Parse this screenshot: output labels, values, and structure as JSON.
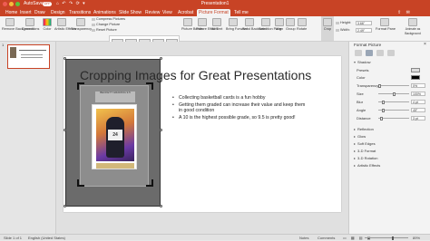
{
  "titlebar": {
    "autosave_label": "AutoSave",
    "toggle_label": "OFF",
    "quick_access": "⌂ ↶ ↷ ⟳ ▾",
    "window_title": "Presentation1"
  },
  "tabs": [
    "Home",
    "Insert",
    "Draw",
    "Design",
    "Transitions",
    "Animations",
    "Slide Show",
    "Review",
    "View",
    "Acrobat",
    "Picture Format",
    "Tell me"
  ],
  "active_tab": "Picture Format",
  "ribbon": {
    "remove_background": "Remove Background",
    "corrections": "Corrections",
    "color": "Color",
    "artistic_effects": "Artistic Effects",
    "transparency": "Transparency",
    "compress_pictures": "Compress Pictures",
    "change_picture": "Change Picture",
    "reset_picture": "Reset Picture",
    "picture_border": "Picture Border",
    "picture_effects": "Picture Effects",
    "alt_text": "Alt Text",
    "bring_forward": "Bring Forward",
    "send_backward": "Send Backward",
    "selection_pane": "Selection Pane",
    "align": "Align",
    "group": "Group",
    "rotate": "Rotate",
    "crop": "Crop",
    "height_label": "Height:",
    "height_value": "3.66\"",
    "width_label": "Width:",
    "width_value": "2.49\"",
    "format_pane": "Format Pane",
    "animate_as_background": "Animate as Background"
  },
  "slides_panel": {
    "slide_number": "1"
  },
  "slide": {
    "title": "Cropping Images for Great Presentations",
    "bullets": [
      "Collecting basketball cards is a fun hobby",
      "Getting them graded can increase their value and keep them in good condition",
      "A 10 is the highest possible grade, so 9.5 is pretty good!"
    ],
    "card_label": "BECKETT GRADING 9.5",
    "jersey_number": "24"
  },
  "format_pane": {
    "title": "Format Picture",
    "section_shadow": "Shadow",
    "presets_label": "Presets",
    "color_label": "Color",
    "color_value": "#000000",
    "transparency_label": "Transparency",
    "transparency_value": "0%",
    "size_label": "Size",
    "size_value": "100%",
    "blur_label": "Blur",
    "blur_value": "4 pt",
    "angle_label": "Angle",
    "angle_value": "45°",
    "distance_label": "Distance",
    "distance_value": "3 pt",
    "sections": [
      "Reflection",
      "Glow",
      "Soft Edges",
      "3-D Format",
      "3-D Rotation",
      "Artistic Effects"
    ]
  },
  "status": {
    "slide_counter": "Slide 1 of 1",
    "language": "English (United States)",
    "notes": "Notes",
    "comments": "Comments",
    "zoom": "89%"
  }
}
